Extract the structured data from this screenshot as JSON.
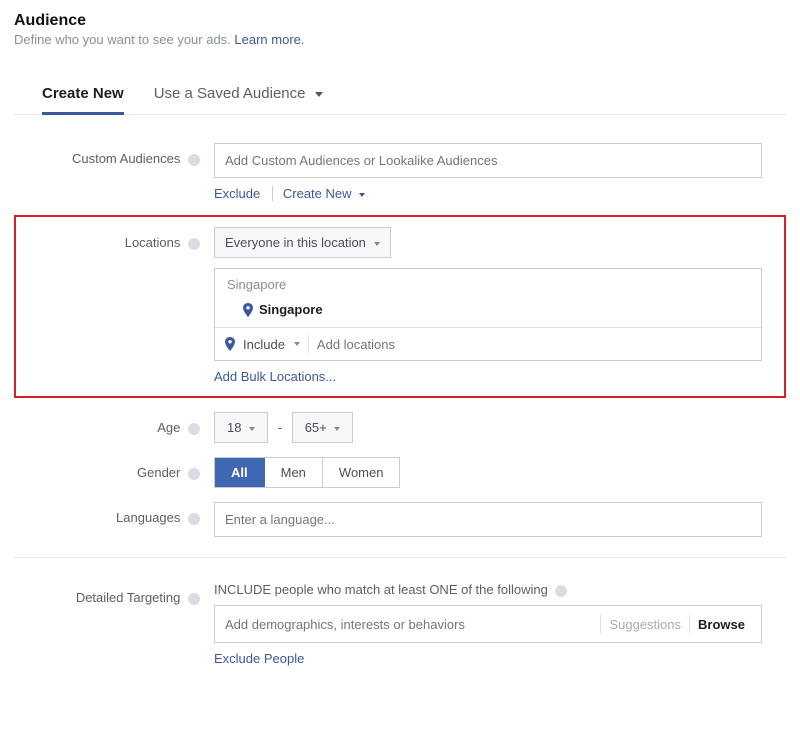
{
  "header": {
    "title": "Audience",
    "subtitle_text": "Define who you want to see your ads. ",
    "learn_more": "Learn more."
  },
  "tabs": {
    "create_new": "Create New",
    "use_saved": "Use a Saved Audience"
  },
  "custom_audiences": {
    "label": "Custom Audiences",
    "placeholder": "Add Custom Audiences or Lookalike Audiences",
    "exclude": "Exclude",
    "create_new": "Create New"
  },
  "locations": {
    "label": "Locations",
    "scope": "Everyone in this location",
    "group_heading": "Singapore",
    "selected_place": "Singapore",
    "include_label": "Include",
    "input_placeholder": "Add locations",
    "bulk_link": "Add Bulk Locations..."
  },
  "age": {
    "label": "Age",
    "min": "18",
    "max": "65+"
  },
  "gender": {
    "label": "Gender",
    "options": {
      "all": "All",
      "men": "Men",
      "women": "Women"
    }
  },
  "languages": {
    "label": "Languages",
    "placeholder": "Enter a language..."
  },
  "detailed_targeting": {
    "label": "Detailed Targeting",
    "caption": "INCLUDE people who match at least ONE of the following",
    "placeholder": "Add demographics, interests or behaviors",
    "suggestions": "Suggestions",
    "browse": "Browse",
    "exclude": "Exclude People"
  }
}
